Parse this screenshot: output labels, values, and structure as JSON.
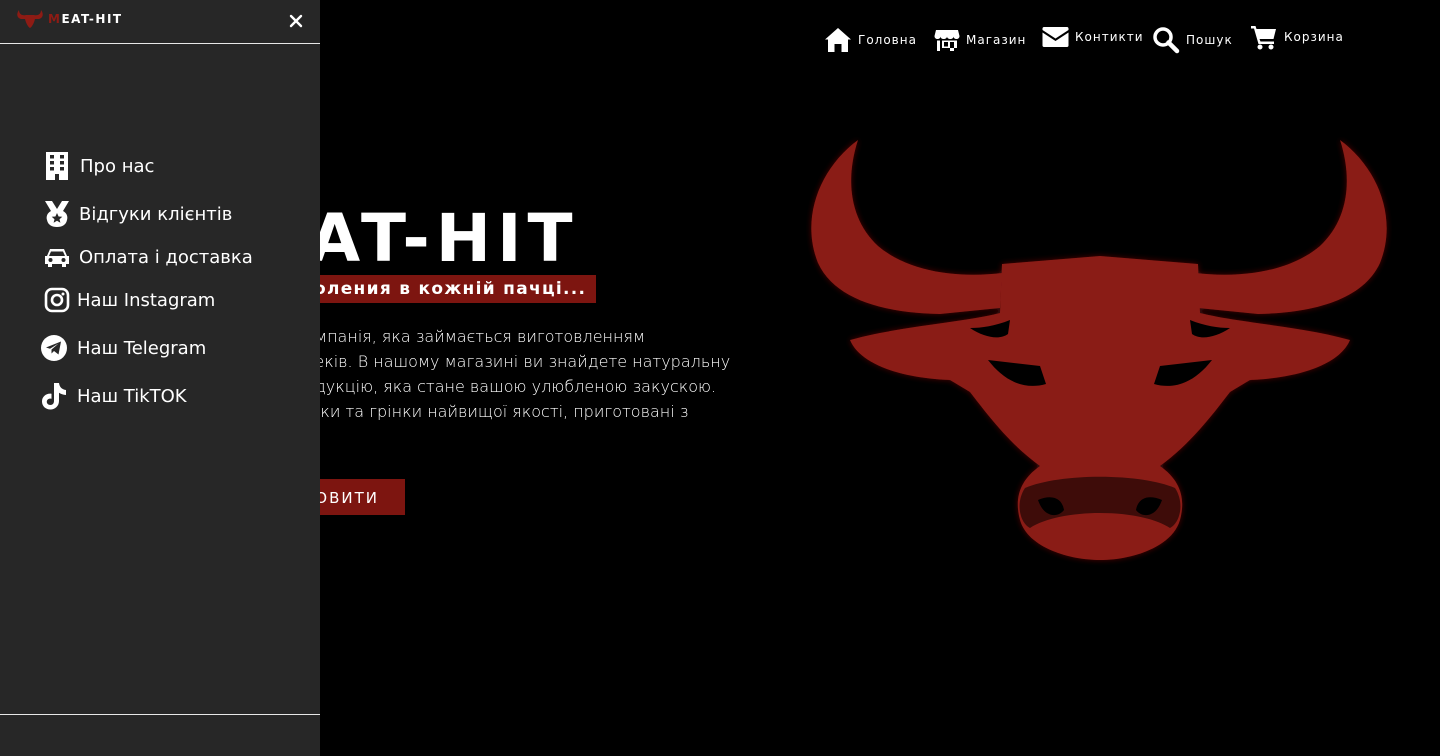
{
  "nav": {
    "home": "Головна",
    "shop": "Магазин",
    "contacts": "Контикти",
    "search": "Пошук",
    "cart": "Корзина"
  },
  "hero": {
    "title": "EAT-HIT",
    "tagline": "оления в кожній пачці...",
    "text": [
      "да компанія, яка займається виготовленням",
      "их снеків. В нашому магазині ви знайдете натуральну",
      "у продукцію, яка стане вашою улюбленою закускою.",
      "пивчики та грінки найвищої якості, приготовані з"
    ],
    "button": "ОВИТИ"
  },
  "sidebar": {
    "brand_first": "M",
    "brand_rest": "EAT-HIT",
    "close_icon": "close-icon",
    "items": [
      {
        "label": "Про нас",
        "icon": "building-icon"
      },
      {
        "label": "Відгуки клієнтів",
        "icon": "medal-icon"
      },
      {
        "label": "Оплата і доставка",
        "icon": "car-icon"
      },
      {
        "label": "Наш Instagram",
        "icon": "instagram-icon"
      },
      {
        "label": "Наш Telegram",
        "icon": "telegram-icon"
      },
      {
        "label": "Наш TikTOK",
        "icon": "tiktok-icon"
      }
    ]
  },
  "colors": {
    "accent": "#7d1510",
    "bull": "#8a1b14",
    "sidebar_bg": "#272727",
    "page_bg": "#000000"
  }
}
